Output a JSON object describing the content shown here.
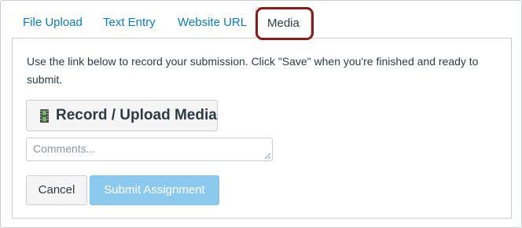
{
  "tabs": [
    {
      "label": "File Upload",
      "active": false
    },
    {
      "label": "Text Entry",
      "active": false
    },
    {
      "label": "Website URL",
      "active": false
    },
    {
      "label": "Media",
      "active": true
    }
  ],
  "media_panel": {
    "instructions": "Use the link below to record your submission. Click \"Save\" when you're finished and ready to submit.",
    "record_button_label": "Record / Upload Media",
    "record_button_icon": "film-strip-icon",
    "comments_placeholder": "Comments...",
    "comments_value": "",
    "cancel_label": "Cancel",
    "submit_label": "Submit Assignment",
    "submit_enabled": false
  },
  "colors": {
    "link": "#0a7bc1",
    "text": "#2d3b45",
    "highlight": "#8b1a1a",
    "submit_disabled_bg": "#8cc9ef",
    "border": "#c7cdd1"
  }
}
